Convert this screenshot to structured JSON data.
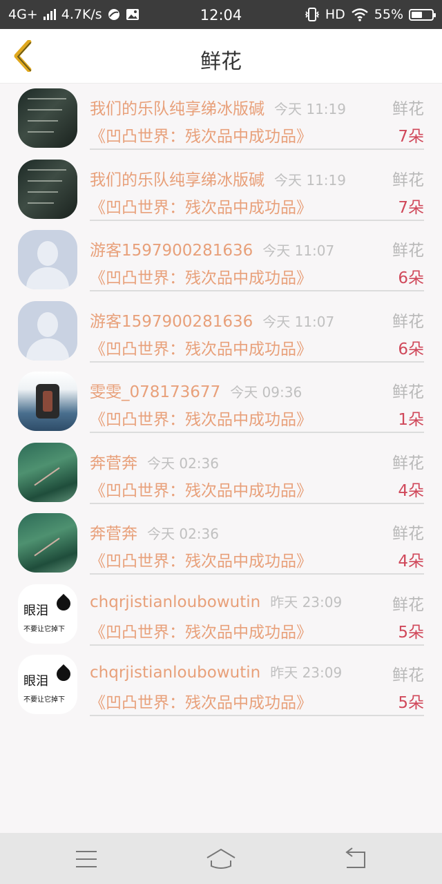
{
  "status_bar": {
    "network": "4G+",
    "speed": "4.7K/s",
    "time": "12:04",
    "hd": "HD",
    "battery": "55%",
    "battery_level": 0.55
  },
  "header": {
    "title": "鲜花",
    "back_icon": "chevron-left-icon",
    "accent_color": "#e0a81e"
  },
  "colors": {
    "name": "#e8a07a",
    "count": "#d0485a",
    "muted": "#c0c0c0"
  },
  "records": [
    {
      "avatar": "dark-text",
      "user": "我们的乐队纯享绨冰版碱",
      "time": "今天 11:19",
      "type": "鲜花",
      "work": "《凹凸世界：残次品中成功品》",
      "count": "7朵"
    },
    {
      "avatar": "dark-text",
      "user": "我们的乐队纯享绨冰版碱",
      "time": "今天 11:19",
      "type": "鲜花",
      "work": "《凹凸世界：残次品中成功品》",
      "count": "7朵"
    },
    {
      "avatar": "default-person",
      "user": "游客1597900281636",
      "time": "今天 11:07",
      "type": "鲜花",
      "work": "《凹凸世界：残次品中成功品》",
      "count": "6朵"
    },
    {
      "avatar": "default-person",
      "user": "游客1597900281636",
      "time": "今天 11:07",
      "type": "鲜花",
      "work": "《凹凸世界：残次品中成功品》",
      "count": "6朵"
    },
    {
      "avatar": "backpack",
      "user": "雯雯_078173677",
      "time": "今天 09:36",
      "type": "鲜花",
      "work": "《凹凸世界：残次品中成功品》",
      "count": "1朵"
    },
    {
      "avatar": "green-forest",
      "user": "奔菅奔",
      "time": "今天 02:36",
      "type": "鲜花",
      "work": "《凹凸世界：残次品中成功品》",
      "count": "4朵"
    },
    {
      "avatar": "green-forest",
      "user": "奔菅奔",
      "time": "今天 02:36",
      "type": "鲜花",
      "work": "《凹凸世界：残次品中成功品》",
      "count": "4朵"
    },
    {
      "avatar": "tears",
      "avatar_text": "眼泪",
      "avatar_sub": "不要让它掉下",
      "user": "chqrjistianloubowutin",
      "time": "昨天 23:09",
      "type": "鲜花",
      "work": "《凹凸世界：残次品中成功品》",
      "count": "5朵"
    },
    {
      "avatar": "tears",
      "avatar_text": "眼泪",
      "avatar_sub": "不要让它掉下",
      "user": "chqrjistianloubowutin",
      "time": "昨天 23:09",
      "type": "鲜花",
      "work": "《凹凸世界：残次品中成功品》",
      "count": "5朵"
    }
  ],
  "nav": {
    "menu_icon": "menu-icon",
    "home_icon": "home-icon",
    "back_icon": "back-arrow-icon"
  }
}
